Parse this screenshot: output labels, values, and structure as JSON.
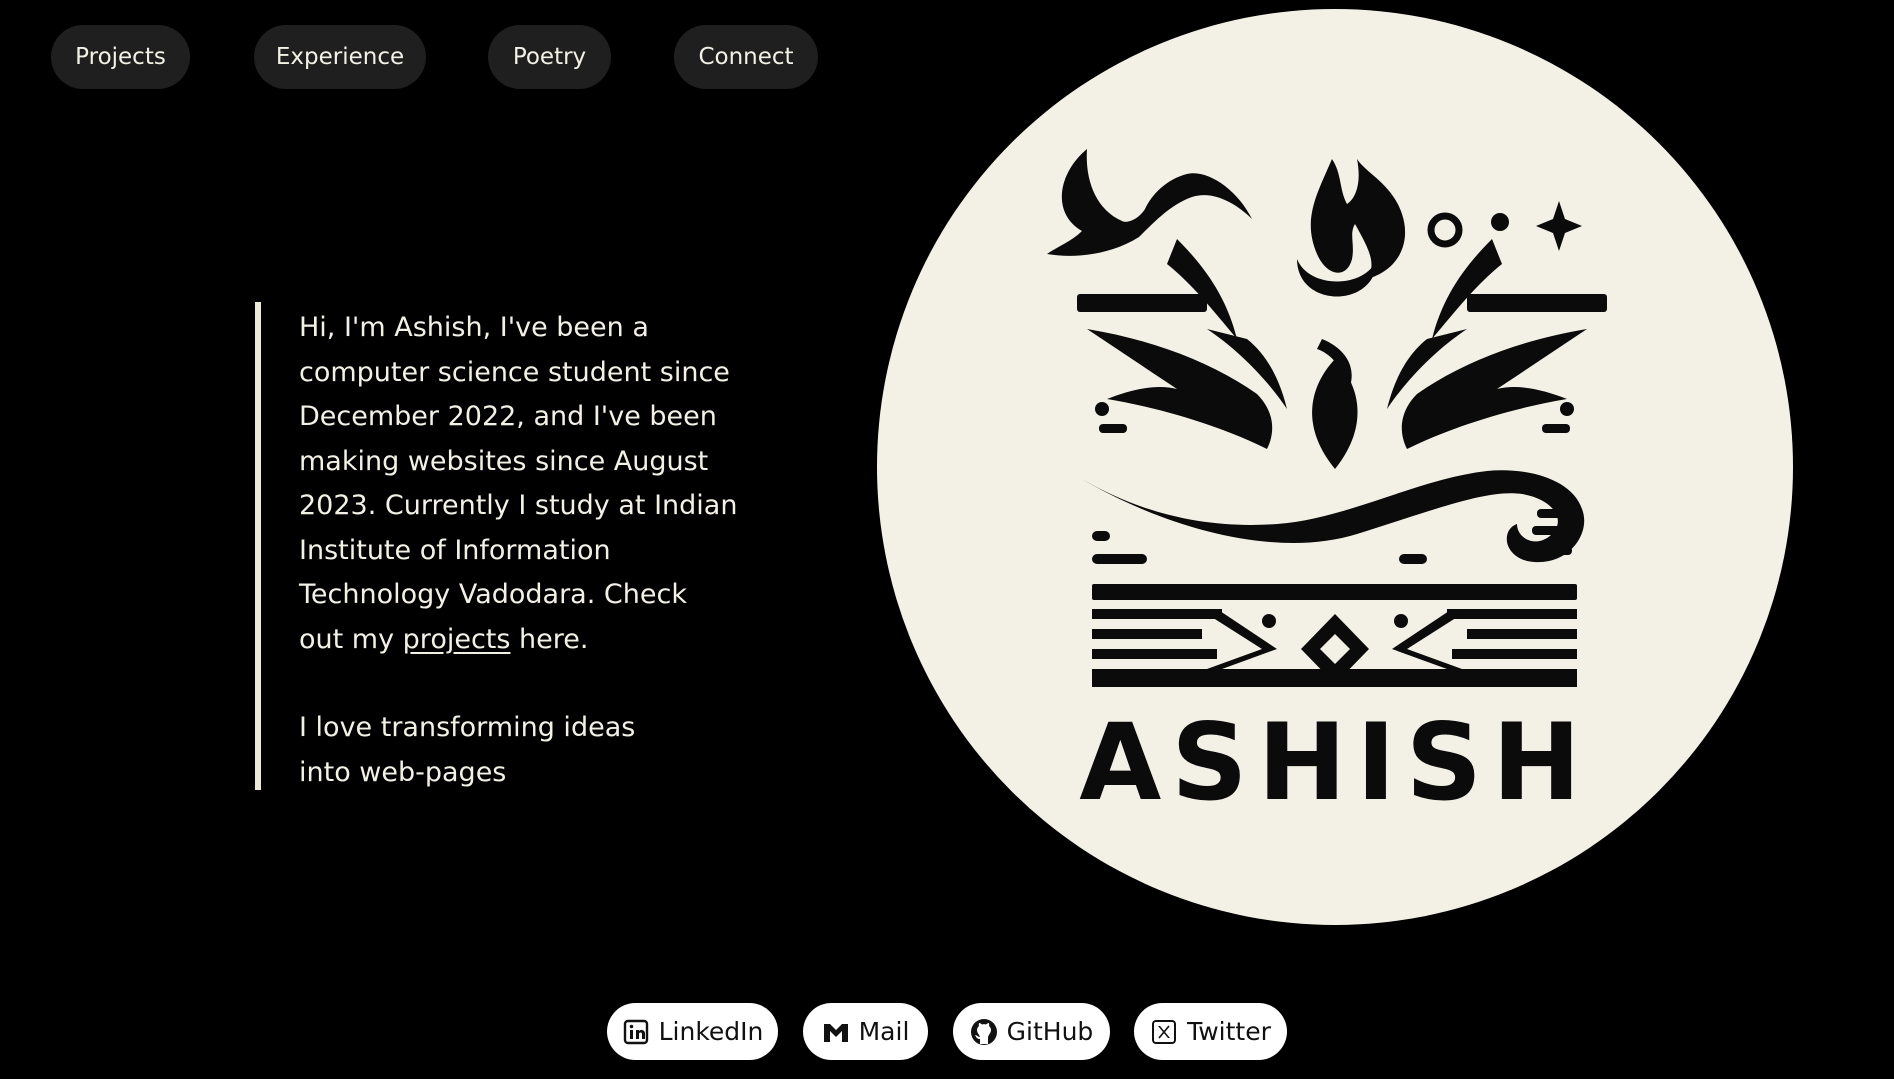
{
  "nav": {
    "items": [
      {
        "label": "Projects"
      },
      {
        "label": "Experience"
      },
      {
        "label": "Poetry"
      },
      {
        "label": "Connect"
      }
    ]
  },
  "intro": {
    "paragraph1_before_link": "Hi, I'm Ashish, I've been a computer science student since December 2022, and I've been making websites since August 2023. Currently I study at Indian Institute of Information Technology Vadodara. Check out my ",
    "projects_link": "projects",
    "paragraph1_after_link": " here.",
    "paragraph2": "I love transforming ideas into web-pages"
  },
  "logo": {
    "wordmark": "ASHISH",
    "background_color": "#f3f1e6",
    "ink_color": "#0b0b0b"
  },
  "social": {
    "items": [
      {
        "label": "LinkedIn",
        "icon": "linkedin-icon"
      },
      {
        "label": "Mail",
        "icon": "mail-icon"
      },
      {
        "label": "GitHub",
        "icon": "github-icon"
      },
      {
        "label": "Twitter",
        "icon": "x-twitter-icon"
      }
    ]
  },
  "colors": {
    "background": "#000000",
    "text": "#f3f1e6",
    "nav_button": "#1f1f1f",
    "social_button": "#ffffff"
  }
}
